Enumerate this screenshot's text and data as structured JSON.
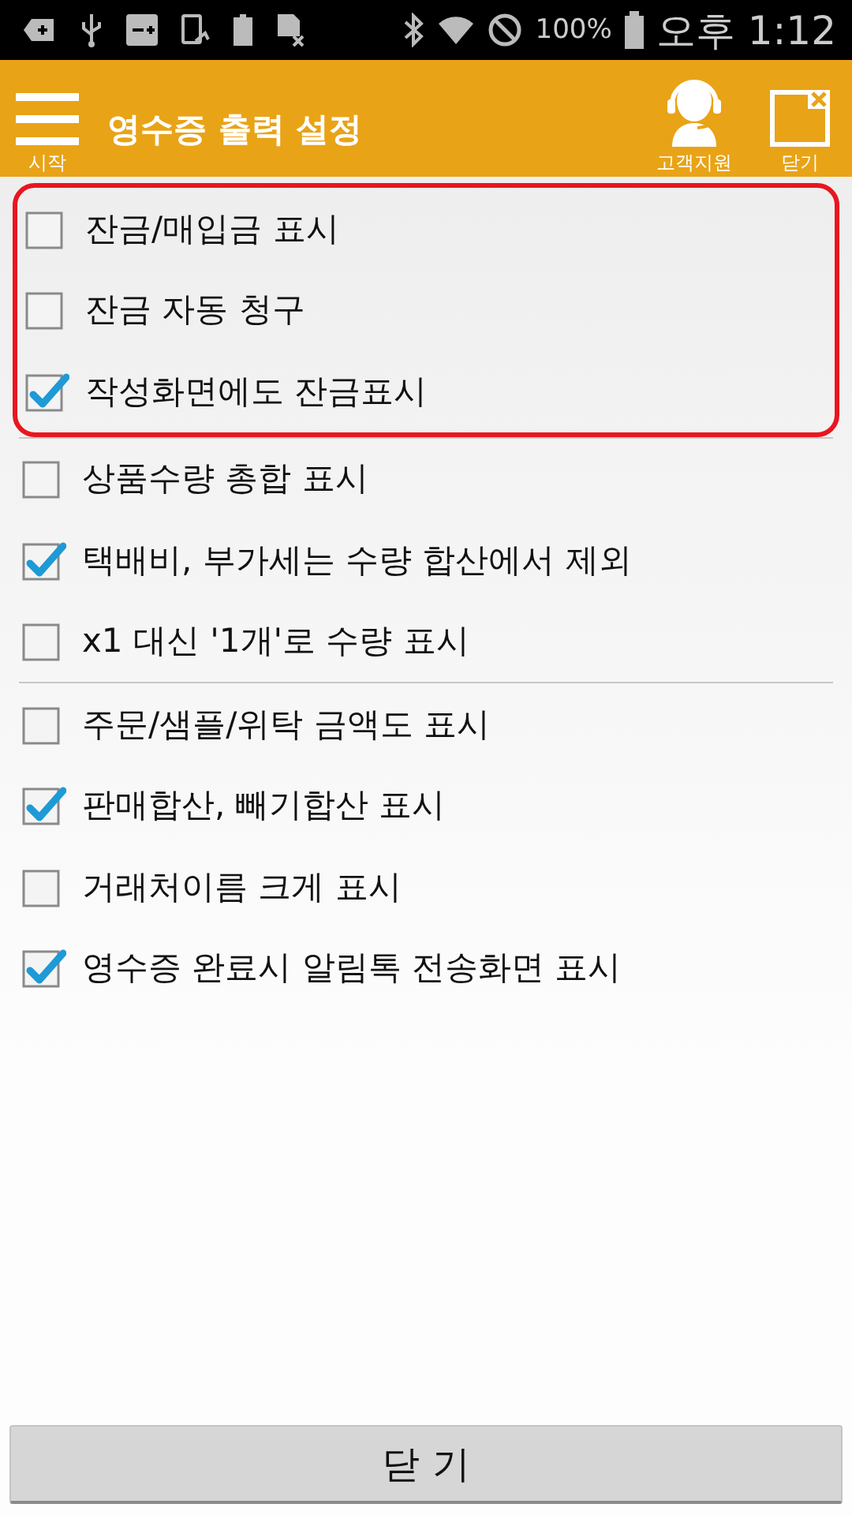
{
  "status_bar": {
    "battery": "100%",
    "time": "오후 1:12"
  },
  "header": {
    "menu_label": "시작",
    "title": "영수증 출력 설정",
    "support_label": "고객지원",
    "close_label": "닫기"
  },
  "groups": [
    {
      "highlighted": true,
      "items": [
        {
          "label": "잔금/매입금 표시",
          "checked": false
        },
        {
          "label": "잔금 자동 청구",
          "checked": false
        },
        {
          "label": "작성화면에도 잔금표시",
          "checked": true
        }
      ]
    },
    {
      "highlighted": false,
      "items": [
        {
          "label": "상품수량 총합 표시",
          "checked": false
        },
        {
          "label": "택배비, 부가세는 수량 합산에서 제외",
          "checked": true
        },
        {
          "label": "x1 대신 '1개'로 수량 표시",
          "checked": false
        }
      ]
    },
    {
      "highlighted": false,
      "items": [
        {
          "label": "주문/샘플/위탁 금액도 표시",
          "checked": false
        },
        {
          "label": "판매합산, 빼기합산 표시",
          "checked": true
        },
        {
          "label": "거래처이름 크게 표시",
          "checked": false
        },
        {
          "label": "영수증 완료시 알림톡 전송화면 표시",
          "checked": true
        }
      ]
    }
  ],
  "close_button": "닫 기"
}
